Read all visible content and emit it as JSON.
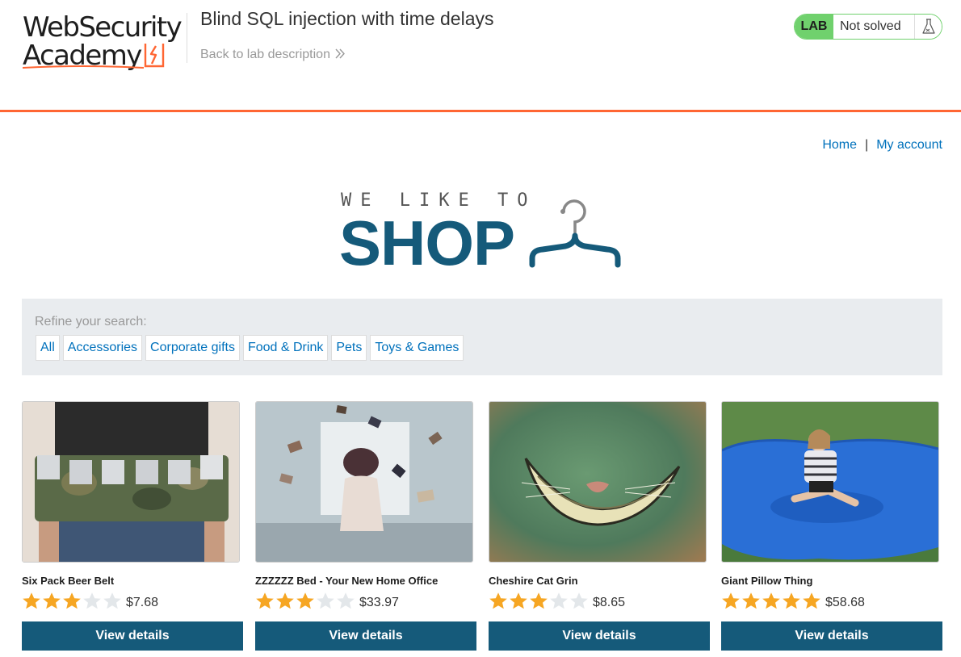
{
  "lab_header": {
    "logo_line1": "WebSecurity",
    "logo_line2": "Academy",
    "title": "Blind SQL injection with time delays",
    "back_link": "Back to lab description",
    "status_badge": "LAB",
    "status_text": "Not solved"
  },
  "nav": {
    "home": "Home",
    "separator": "|",
    "my_account": "My account"
  },
  "banner": {
    "top_text": "WE LIKE TO",
    "main_text": "SHOP"
  },
  "filters": {
    "label": "Refine your search:",
    "items": [
      "All",
      "Accessories",
      "Corporate gifts",
      "Food & Drink",
      "Pets",
      "Toys & Games"
    ]
  },
  "products": [
    {
      "name": "Six Pack Beer Belt",
      "rating": 3,
      "max_rating": 5,
      "price": "$7.68",
      "button": "View details"
    },
    {
      "name": "ZZZZZZ Bed - Your New Home Office",
      "rating": 3,
      "max_rating": 5,
      "price": "$33.97",
      "button": "View details"
    },
    {
      "name": "Cheshire Cat Grin",
      "rating": 3,
      "max_rating": 5,
      "price": "$8.65",
      "button": "View details"
    },
    {
      "name": "Giant Pillow Thing",
      "rating": 5,
      "max_rating": 5,
      "price": "$58.68",
      "button": "View details"
    }
  ],
  "colors": {
    "accent_orange": "#ff6633",
    "brand_blue": "#155a7a",
    "link_blue": "#0071bc",
    "lab_green": "#70d16d",
    "star_filled": "#f6a623",
    "star_empty": "#e3e7ea"
  },
  "icons": {
    "logo_mark": "lightning-bolt-icon",
    "back_chevron": "double-chevron-right-icon",
    "status_flask": "flask-icon",
    "banner_hanger": "clothes-hanger-icon",
    "rating_star": "star-icon"
  }
}
